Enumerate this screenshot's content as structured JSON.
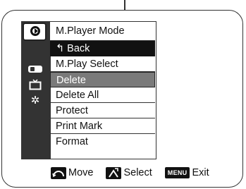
{
  "menu": {
    "title": "M.Player Mode",
    "items": [
      {
        "label": "↰ Back"
      },
      {
        "label": "M.Play Select"
      },
      {
        "label": "Delete"
      },
      {
        "label": "Delete All"
      },
      {
        "label": "Protect"
      },
      {
        "label": "Print Mark"
      },
      {
        "label": "Format"
      }
    ],
    "selected_item": "Delete",
    "side_icons": [
      "mode-player-icon",
      "battery-icon",
      "tv-icon",
      "gear-icon"
    ]
  },
  "footer": {
    "move_label": "Move",
    "select_label": "Select",
    "menu_badge": "MENU",
    "exit_label": "Exit"
  },
  "colors": {
    "selected_bg": "#7a7a7a",
    "back_bg": "#111111",
    "sidebar_bg": "#333333"
  }
}
